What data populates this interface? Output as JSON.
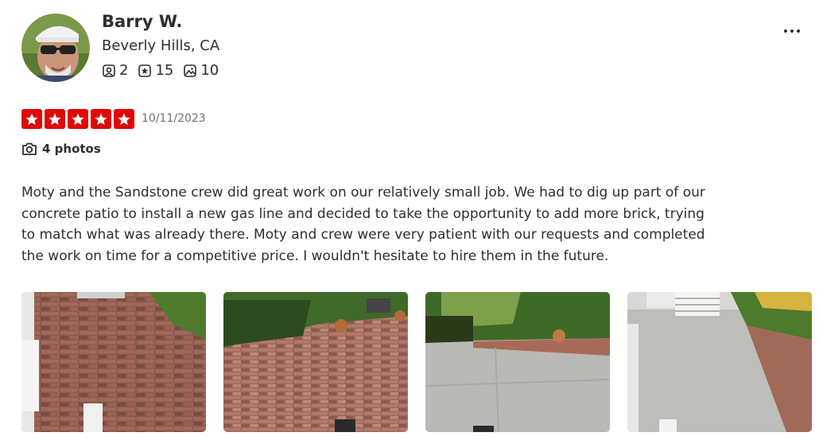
{
  "reviewer": {
    "name": "Barry W.",
    "location": "Beverly Hills, CA",
    "stats": {
      "friends": "2",
      "reviews": "15",
      "photos": "10"
    }
  },
  "review": {
    "rating": 5,
    "date": "10/11/2023",
    "photos_label": "4 photos",
    "text": "Moty and the Sandstone crew did great work on our relatively small job. We had to dig up part of our concrete patio to install a new gas line and decided to take the opportunity to add more brick, trying to match what was already there. Moty and crew were very patient with our requests and completed the work on time for a competitive price. I wouldn't hesitate to hire them in the future."
  },
  "icons": {
    "friends": "friends-icon",
    "reviews": "reviews-star-icon",
    "photos": "photo-icon",
    "camera": "camera-icon",
    "more": "more-options-icon"
  },
  "colors": {
    "star": "#e00707",
    "text": "#2d2e2f",
    "muted": "#6e7072"
  }
}
